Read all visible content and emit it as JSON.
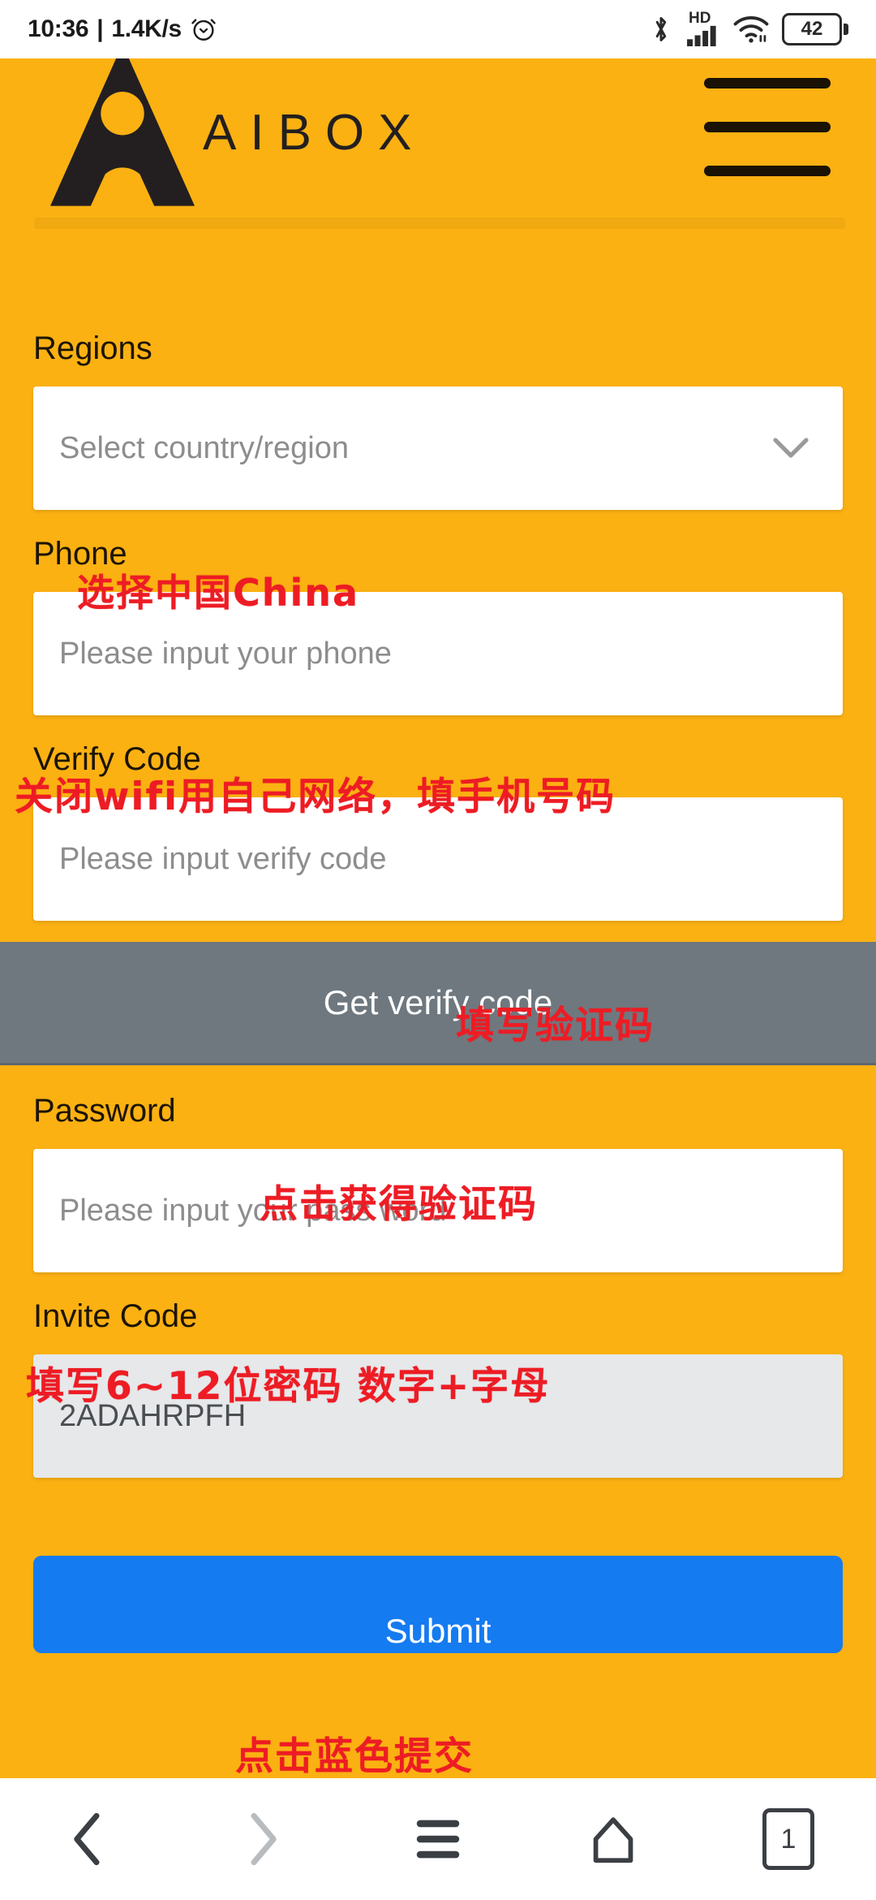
{
  "status_bar": {
    "time": "10:36",
    "separator": "|",
    "network_speed": "1.4K/s",
    "alarm_icon": "alarm-clock-icon",
    "bluetooth_icon": "bluetooth-icon",
    "hd_label": "HD",
    "signal_icon": "cellular-signal-icon",
    "wifi_icon": "wifi-icon",
    "battery_level": "42"
  },
  "header": {
    "brand_name": "AIBOX",
    "logo_icon": "aibox-logo-icon",
    "menu_icon": "hamburger-menu-icon"
  },
  "form": {
    "regions": {
      "label": "Regions",
      "placeholder": "Select country/region",
      "value": "",
      "chevron_icon": "chevron-down-icon"
    },
    "phone": {
      "label": "Phone",
      "placeholder": "Please input your phone",
      "value": ""
    },
    "verify_code": {
      "label": "Verify Code",
      "placeholder": "Please input verify code",
      "value": ""
    },
    "get_code_button": "Get verify code",
    "password": {
      "label": "Password",
      "placeholder": "Please input your pass word",
      "value": ""
    },
    "invite_code": {
      "label": "Invite Code",
      "placeholder": "",
      "value": "2ADAHRPFH"
    },
    "submit_button": "Submit"
  },
  "annotations": [
    {
      "text": "选择中国China",
      "note": "region-annotation"
    },
    {
      "text": "关闭wifi用自己网络，填手机号码",
      "note": "phone-annotation"
    },
    {
      "text": "填写验证码",
      "note": "verify-code-annotation"
    },
    {
      "text": "点击获得验证码",
      "note": "get-code-annotation"
    },
    {
      "text": "填写6~12位密码 数字+字母",
      "note": "password-annotation"
    },
    {
      "text": "点击蓝色提交",
      "note": "submit-annotation"
    }
  ],
  "bottom_nav": {
    "back_icon": "chevron-left-icon",
    "forward_icon": "chevron-right-icon",
    "menu_icon": "menu-lines-icon",
    "home_icon": "home-icon",
    "tab_count": "1"
  },
  "colors": {
    "background": "#FBB112",
    "submit": "#157BF0",
    "get_code": "#6F787F",
    "annotation": "#ED1C24",
    "logo": "#231F20"
  }
}
